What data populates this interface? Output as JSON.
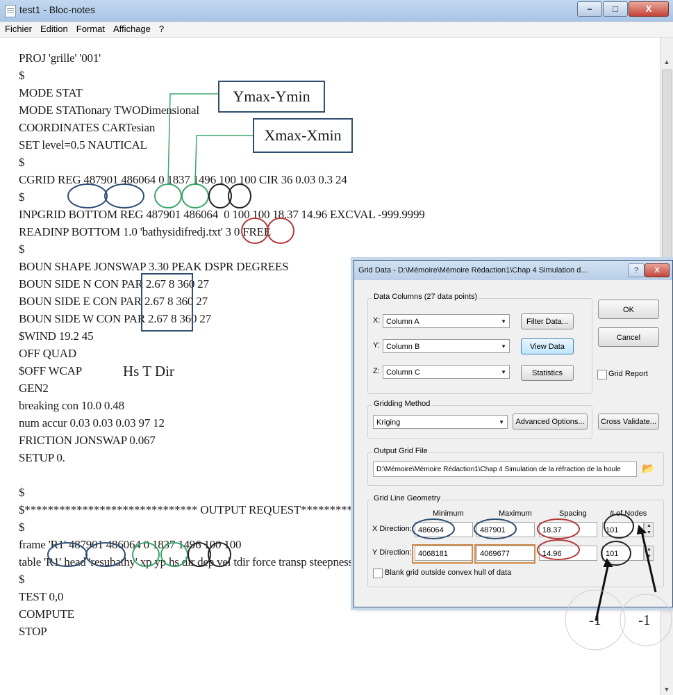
{
  "notepad": {
    "title": "test1 - Bloc-notes",
    "menu": [
      "Fichier",
      "Edition",
      "Format",
      "Affichage",
      "?"
    ],
    "lines": [
      "PROJ 'grille' '001'",
      "$",
      "MODE STAT",
      "MODE STATionary TWODimensional",
      "COORDINATES CARTesian",
      "SET level=0.5 NAUTICAL",
      "$",
      "CGRID REG 487901 486064 0 1837 1496 100 100 CIR 36 0.03 0.3 24",
      "$",
      "INPGRID BOTTOM REG 487901 486064  0 100 100 18.37 14.96 EXCVAL -999.9999",
      "READINP BOTTOM 1.0 'bathysidifredj.txt' 3 0 FREE",
      "$",
      "BOUN SHAPE JONSWAP 3.30 PEAK DSPR DEGREES",
      "BOUN SIDE N CON PAR 2.67 8 360 27",
      "BOUN SIDE E CON PAR 2.67 8 360 27",
      "BOUN SIDE W CON PAR 2.67 8 360 27",
      "$WIND 19.2 45",
      "OFF QUAD",
      "$OFF WCAP",
      "GEN2",
      "breaking con 10.0 0.48",
      "num accur 0.03 0.03 0.03 97 12",
      "FRICTION JONSWAP 0.067",
      "SETUP 0.",
      "",
      "$",
      "$****************************** OUTPUT REQUEST*****************************",
      "$",
      "frame 'R1' 487901 486064 0 1837 1496 100 100",
      "table 'R1' head 'resubathy' xp yp hs dir dep vel tdir force transp steepness wlen lwavp",
      "$",
      "TEST 0,0",
      "COMPUTE",
      "STOP"
    ]
  },
  "annotations": {
    "ymax_ymin": "Ymax-Ymin",
    "xmax_xmin": "Xmax-Xmin",
    "hs_t_dir": "Hs T Dir",
    "minus_one_a": "-1",
    "minus_one_b": "-1"
  },
  "dialog": {
    "title": "Grid Data - D:\\Mémoire\\Mémoire Rédaction1\\Chap 4 Simulation d...",
    "help": "?",
    "close": "X",
    "data_columns_label": "Data Columns    (27 data points)",
    "x_label": "X:",
    "y_label": "Y:",
    "z_label": "Z:",
    "x_column": "Column A",
    "y_column": "Column B",
    "z_column": "Column C",
    "filter_data": "Filter Data...",
    "view_data": "View Data",
    "statistics": "Statistics",
    "ok": "OK",
    "cancel": "Cancel",
    "grid_report": "Grid Report",
    "gridding_method_label": "Gridding Method",
    "gridding_method": "Kriging",
    "advanced_options": "Advanced Options...",
    "cross_validate": "Cross Validate...",
    "output_grid_file_label": "Output Grid File",
    "output_grid_file": "D:\\Mémoire\\Mémoire Rédaction1\\Chap 4 Simulation de la réfraction de la houle",
    "grid_line_geometry_label": "Grid Line Geometry",
    "col_minimum": "Minimum",
    "col_maximum": "Maximum",
    "col_spacing": "Spacing",
    "col_nodes": "# of Nodes",
    "x_direction": "X Direction:",
    "y_direction": "Y Direction:",
    "x_min": "486064",
    "x_max": "487901",
    "x_spacing": "18.37",
    "x_nodes": "101",
    "y_min": "4068181",
    "y_max": "4069677",
    "y_spacing": "14.96",
    "y_nodes": "101",
    "blank_grid": "Blank grid outside convex hull of data"
  }
}
